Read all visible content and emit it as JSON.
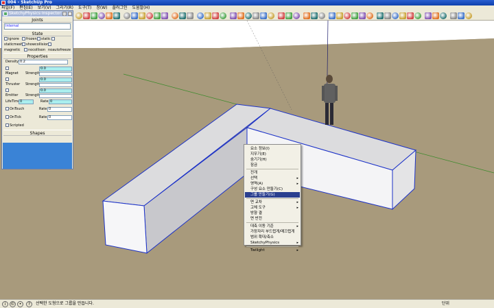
{
  "window": {
    "title": "004 - SketchUp Pro"
  },
  "menu": {
    "items": [
      "파일(F)",
      "편집(E)",
      "보기(V)",
      "그리기(R)",
      "도구(T)",
      "창(W)",
      "플러그인",
      "도움말(H)"
    ]
  },
  "toolbar": {
    "icons": [
      "new-icon",
      "open-icon",
      "save-icon",
      "cut-icon",
      "copy-icon",
      "paste-icon",
      "erase-icon",
      "undo-icon",
      "redo-icon",
      "print-icon",
      "model-info-icon",
      "select-icon",
      "make-component-icon",
      "paint-icon",
      "eraser-icon",
      "rectangle-icon",
      "line-icon",
      "circle-icon",
      "arc-icon",
      "polygon-icon",
      "freehand-icon",
      "move-icon",
      "push-pull-icon",
      "rotate-icon",
      "follow-me-icon",
      "scale-icon",
      "offset-icon",
      "tape-icon",
      "dimension-icon",
      "protractor-icon",
      "text-icon",
      "axes-icon",
      "3d-text-icon",
      "orbit-icon",
      "pan-icon",
      "zoom-icon",
      "zoom-window-icon",
      "zoom-extents-icon",
      "previous-icon",
      "next-icon",
      "views-iso-icon",
      "views-top-icon",
      "views-front-icon",
      "views-right-icon",
      "views-back-icon",
      "views-left-icon",
      "xray-icon",
      "wireframe-icon",
      "hidden-line-icon",
      "shaded-icon",
      "textured-icon",
      "monochrome-icon",
      "walk-icon",
      "look-around-icon",
      "position-camera-icon",
      "section-plane-icon",
      "physics-play-icon",
      "physics-reset-icon",
      "joint-icon"
    ]
  },
  "panel": {
    "title": "SketchyPhysics Inspector",
    "sections": {
      "joints": "Joints",
      "state": "State",
      "properties": "Properties",
      "shapes": "Shapes"
    },
    "joints_value": "Internal",
    "state_checks": [
      "ignore",
      "frozen",
      "static",
      "staticmesh",
      "showcollision",
      "noautofreeze",
      "magnetic",
      "nocollison"
    ],
    "density_label": "Density",
    "density_value": "0.2",
    "magnet_label": "Magnet",
    "thruster_label": "Thruster",
    "emitter_label": "Emitter",
    "strength_label": "Strength",
    "strength_values": [
      "0.0",
      "0.0",
      "0.0"
    ],
    "lifetime_label": "LifeTime",
    "lifetime_value": "0",
    "rate_label": "Rate",
    "rate_value": "0",
    "ontouch_label": "OnTouch",
    "ontick_label": "OnTick",
    "ontouch_rate": "0",
    "ontick_rate": "0",
    "scripted_label": "Scripted"
  },
  "context_menu": {
    "items": [
      {
        "label": "요소 정보(I)",
        "arrow": false,
        "highlight": false
      },
      {
        "label": "지우기(E)",
        "arrow": false,
        "highlight": false
      },
      {
        "label": "숨기기(H)",
        "arrow": false,
        "highlight": false
      },
      {
        "label": "잠금",
        "arrow": false,
        "highlight": false
      },
      {
        "label": "전개",
        "arrow": false,
        "highlight": false
      },
      {
        "label": "선택",
        "arrow": true,
        "highlight": false
      },
      {
        "label": "영역(A)",
        "arrow": true,
        "highlight": false
      },
      {
        "label": "구성 요소 만들기(C)",
        "arrow": false,
        "highlight": false
      },
      {
        "label": "그룹 만들기(G)",
        "arrow": false,
        "highlight": true
      },
      {
        "label": "면 교차",
        "arrow": true,
        "highlight": false
      },
      {
        "label": "고체 도구",
        "arrow": true,
        "highlight": false
      },
      {
        "label": "방향 결",
        "arrow": false,
        "highlight": false
      },
      {
        "label": "면 반전",
        "arrow": false,
        "highlight": false
      },
      {
        "label": "대축 이동 기준",
        "arrow": true,
        "highlight": false
      },
      {
        "label": "가장자리 부드럽게/매끄럽게",
        "arrow": false,
        "highlight": false
      },
      {
        "label": "범위 확대/축소",
        "arrow": false,
        "highlight": false
      },
      {
        "label": "SketchyPhysics",
        "arrow": true,
        "highlight": false
      },
      {
        "label": "Twilight",
        "arrow": true,
        "highlight": false
      }
    ]
  },
  "statusbar": {
    "message": "선택한 도형으로 그룹을 만듭니다.",
    "measurements_label": "단위"
  },
  "colors": {
    "ground": "#a89a7c",
    "sky": "#ffffff",
    "selection": "#1c32c8",
    "highlight": "#2a3f8f"
  }
}
